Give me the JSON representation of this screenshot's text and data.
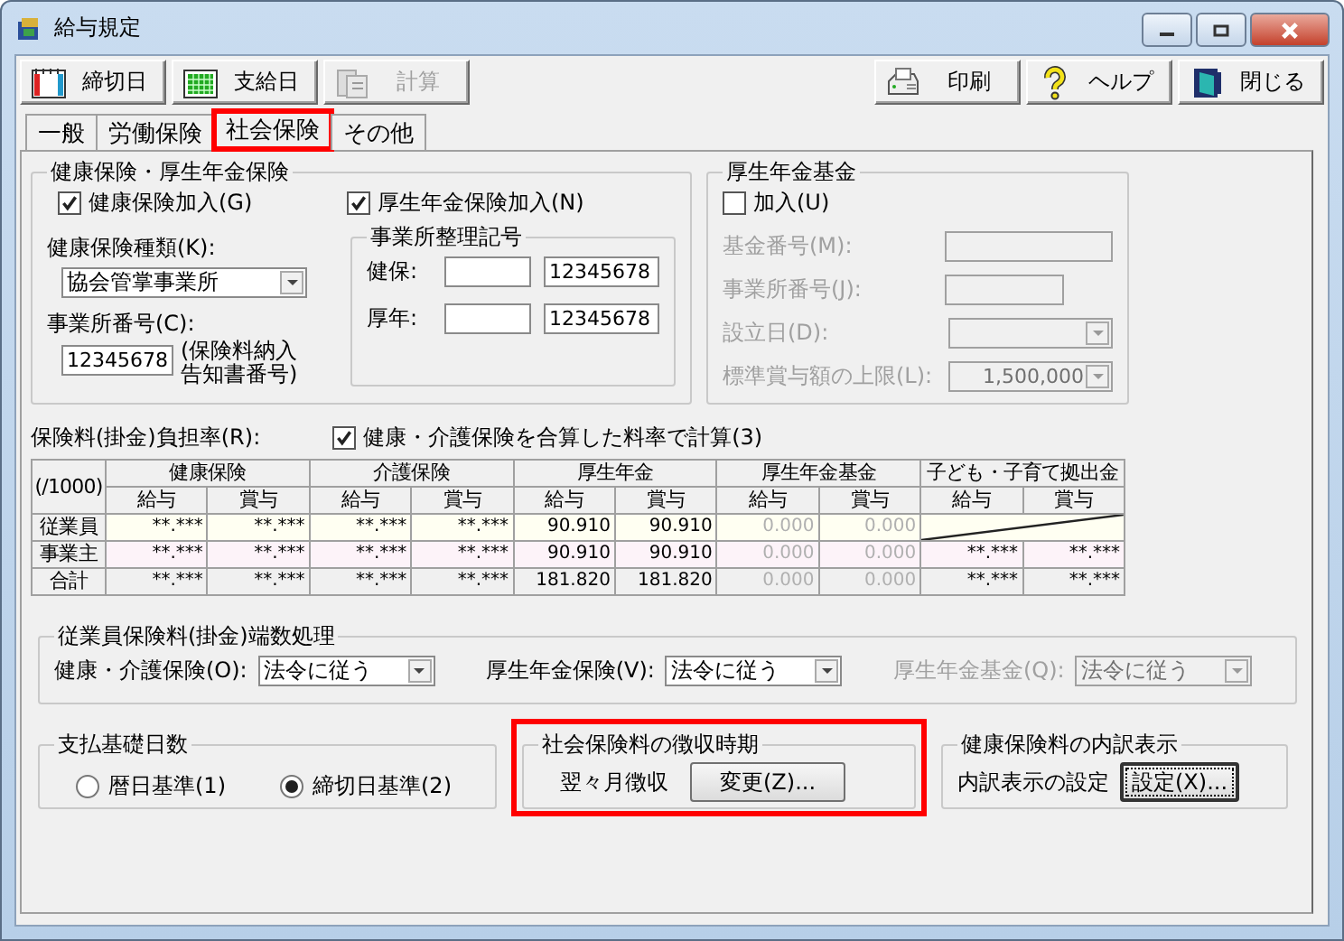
{
  "window": {
    "title": "給与規定"
  },
  "toolbar": {
    "left": [
      {
        "label": "締切日",
        "kind": "cutoff",
        "disabled": false
      },
      {
        "label": "支給日",
        "kind": "payday",
        "disabled": false
      },
      {
        "label": "計算",
        "kind": "calc",
        "disabled": true
      }
    ],
    "right": [
      {
        "label": "印刷",
        "kind": "print",
        "disabled": false
      },
      {
        "label": "ヘルプ",
        "kind": "help",
        "disabled": false
      },
      {
        "label": "閉じる",
        "kind": "close",
        "disabled": false
      }
    ]
  },
  "tabs": [
    {
      "label": "一般",
      "selected": false,
      "highlighted": false
    },
    {
      "label": "労働保険",
      "selected": false,
      "highlighted": false
    },
    {
      "label": "社会保険",
      "selected": true,
      "highlighted": true
    },
    {
      "label": "その他",
      "selected": false,
      "highlighted": false
    }
  ],
  "health_pension": {
    "title": "健康保険・厚生年金保険",
    "checkboxes": [
      {
        "label": "健康保険加入(G)",
        "checked": true
      },
      {
        "label": "厚生年金保険加入(N)",
        "checked": true
      }
    ],
    "type_label": "健康保険種類(K):",
    "type_value": "協会管掌事業所",
    "office_no_label": "事業所番号(C):",
    "office_no_value": "12345678",
    "office_no_note": "(保険料納入告知書番号)",
    "office_code": {
      "title": "事業所整理記号",
      "rows": [
        {
          "label": "健保:",
          "value": "12345678"
        },
        {
          "label": "厚年:",
          "value": "12345678"
        }
      ]
    }
  },
  "pension_fund": {
    "title": "厚生年金基金",
    "join": {
      "label": "加入(U)",
      "checked": false
    },
    "fields": [
      {
        "label": "基金番号(M):",
        "kind": "text",
        "disabled": true
      },
      {
        "label": "事業所番号(J):",
        "kind": "short",
        "disabled": true
      },
      {
        "label": "設立日(D):",
        "kind": "combo",
        "disabled": true
      },
      {
        "label": "標準賞与額の上限(L):",
        "kind": "combo",
        "value": "1,500,000",
        "disabled": true
      }
    ]
  },
  "rates": {
    "label": "保険料(掛金)負担率(R):",
    "combined": {
      "label": "健康・介護保険を合算した料率で計算(3)",
      "checked": true
    },
    "corner": "(/1000)",
    "groups": [
      "健康保険",
      "介護保険",
      "厚生年金",
      "厚生年金基金",
      "子ども・子育て拠出金"
    ],
    "subheads": [
      "給与",
      "賞与",
      "給与",
      "賞与",
      "給与",
      "賞与",
      "給与",
      "賞与",
      "給与",
      "賞与"
    ],
    "rows": [
      {
        "label": "従業員",
        "kind": "employee",
        "crossed": true,
        "cells": [
          {
            "text": "**.***",
            "disabled": false
          },
          {
            "text": "**.***",
            "disabled": false
          },
          {
            "text": "**.***",
            "disabled": false
          },
          {
            "text": "**.***",
            "disabled": false
          },
          {
            "text": "90.910",
            "disabled": false
          },
          {
            "text": "90.910",
            "disabled": false
          },
          {
            "text": "0.000",
            "disabled": true
          },
          {
            "text": "0.000",
            "disabled": true
          }
        ]
      },
      {
        "label": "事業主",
        "kind": "employer",
        "cells": [
          {
            "text": "**.***",
            "disabled": false
          },
          {
            "text": "**.***",
            "disabled": false
          },
          {
            "text": "**.***",
            "disabled": false
          },
          {
            "text": "**.***",
            "disabled": false
          },
          {
            "text": "90.910",
            "disabled": false
          },
          {
            "text": "90.910",
            "disabled": false
          },
          {
            "text": "0.000",
            "disabled": true
          },
          {
            "text": "0.000",
            "disabled": true
          },
          {
            "text": "**.***",
            "disabled": false
          },
          {
            "text": "**.***",
            "disabled": false
          }
        ]
      },
      {
        "label": "合計",
        "kind": "total",
        "cells": [
          {
            "text": "**.***",
            "disabled": false
          },
          {
            "text": "**.***",
            "disabled": false
          },
          {
            "text": "**.***",
            "disabled": false
          },
          {
            "text": "**.***",
            "disabled": false
          },
          {
            "text": "181.820",
            "disabled": false
          },
          {
            "text": "181.820",
            "disabled": false
          },
          {
            "text": "0.000",
            "disabled": true
          },
          {
            "text": "0.000",
            "disabled": true
          },
          {
            "text": "**.***",
            "disabled": false
          },
          {
            "text": "**.***",
            "disabled": false
          }
        ]
      }
    ]
  },
  "rounding": {
    "title": "従業員保険料(掛金)端数処理",
    "items": [
      {
        "label": "健康・介護保険(O):",
        "value": "法令に従う",
        "disabled": false
      },
      {
        "label": "厚生年金保険(V):",
        "value": "法令に従う",
        "disabled": false
      },
      {
        "label": "厚生年金基金(Q):",
        "value": "法令に従う",
        "disabled": true
      }
    ]
  },
  "payment_days": {
    "title": "支払基礎日数",
    "options": [
      {
        "label": "暦日基準(1)",
        "selected": false
      },
      {
        "label": "締切日基準(2)",
        "selected": true
      }
    ]
  },
  "collection": {
    "title": "社会保険料の徴収時期",
    "highlighted": true,
    "value": "翌々月徴収",
    "button": "変更(Z)..."
  },
  "breakdown": {
    "title": "健康保険料の内訳表示",
    "label": "内訳表示の設定",
    "button": "設定(X)..."
  }
}
